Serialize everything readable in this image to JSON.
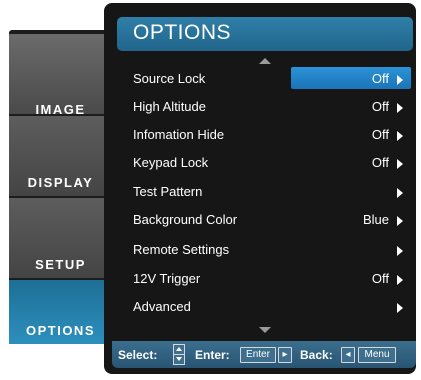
{
  "tabs": [
    {
      "label": "IMAGE"
    },
    {
      "label": "DISPLAY"
    },
    {
      "label": "SETUP"
    },
    {
      "label": "OPTIONS",
      "active": true
    }
  ],
  "menu": {
    "title": "OPTIONS",
    "items": [
      {
        "label": "Source Lock",
        "value": "Off",
        "selected": true
      },
      {
        "label": "High Altitude",
        "value": "Off"
      },
      {
        "label": "Infomation Hide",
        "value": "Off"
      },
      {
        "label": "Keypad Lock",
        "value": "Off"
      },
      {
        "label": "Test Pattern",
        "value": ""
      },
      {
        "label": "Background Color",
        "value": "Blue"
      },
      {
        "label": "Remote Settings",
        "value": ""
      },
      {
        "label": "12V Trigger",
        "value": "Off"
      },
      {
        "label": "Advanced",
        "value": ""
      }
    ]
  },
  "help": {
    "select_label": "Select:",
    "enter_label": "Enter:",
    "enter_key": "Enter",
    "back_label": "Back:",
    "menu_key": "Menu"
  },
  "icons": {
    "scroll_up": "triangle-up-icon",
    "scroll_down": "triangle-down-icon",
    "submenu": "caret-right-icon",
    "updown": "up-down-keys-icon"
  },
  "colors": {
    "accent": "#2c93d6",
    "title_bar": "#2f7fa8",
    "active_tab": "#2d8fbd",
    "panel": "#161616"
  }
}
